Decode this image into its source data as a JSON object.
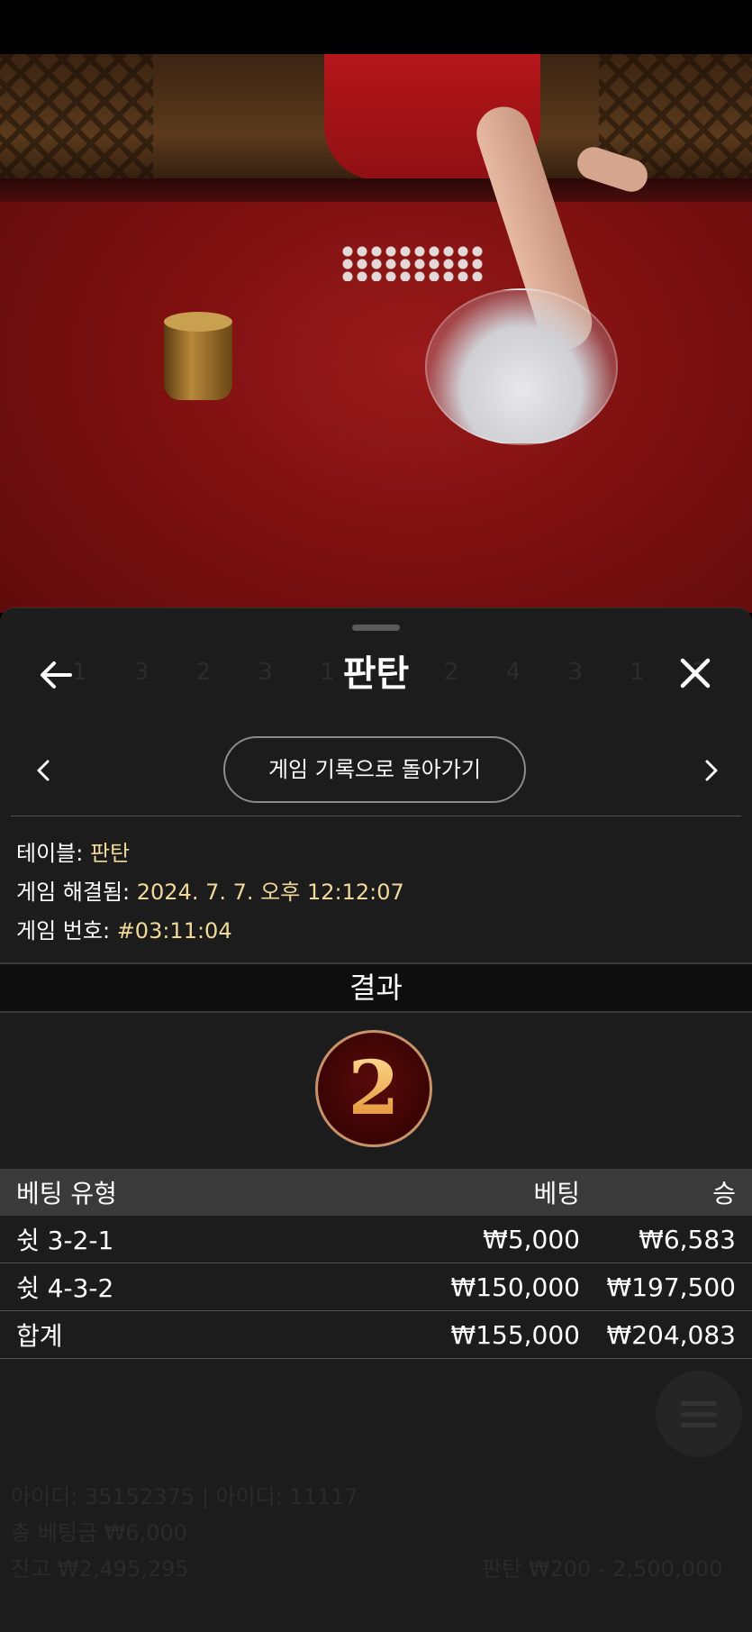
{
  "header": {
    "title": "판탄",
    "back_icon": "back-arrow-icon",
    "close_icon": "close-icon"
  },
  "nav": {
    "back_to_history_label": "게임 기록으로 돌아가기",
    "prev_icon": "chevron-left-icon",
    "next_icon": "chevron-right-icon"
  },
  "game_info": {
    "table_label": "테이블:",
    "table_value": "판탄",
    "resolved_label": "게임 해결됨:",
    "resolved_value": "2024. 7. 7. 오후 12:12:07",
    "game_no_label": "게임 번호:",
    "game_no_value": "#03:11:04"
  },
  "result": {
    "heading": "결과",
    "value": "2"
  },
  "bets_table": {
    "headers": {
      "type": "베팅 유형",
      "bet": "베팅",
      "win": "승"
    },
    "rows": [
      {
        "type": "쉿 3-2-1",
        "bet": "₩5,000",
        "win": "₩6,583"
      },
      {
        "type": "쉿 4-3-2",
        "bet": "₩150,000",
        "win": "₩197,500"
      }
    ],
    "total": {
      "type": "합계",
      "bet": "₩155,000",
      "win": "₩204,083"
    }
  },
  "background": {
    "ghost_numbers": "1 3 2 3 1 2 2 4 3 1 2 2",
    "footer_line1": "아이디: 35152375 | 아이디: 11117",
    "footer_line2": "총 베팅금 ₩6,000",
    "footer_line3": "잔고 ₩2,495,295",
    "footer_right": "판탄 ₩200 - 2,500,000"
  },
  "colors": {
    "sheet_bg": "#1c1c1c",
    "accent_value": "#f1d99a",
    "ball_border": "#c8926a"
  }
}
